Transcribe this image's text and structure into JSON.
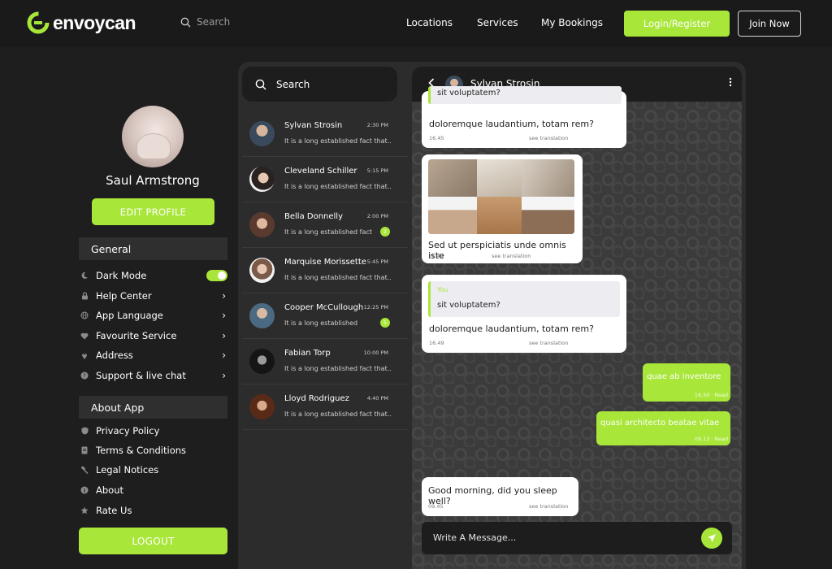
{
  "brand": {
    "name": "envoycan",
    "accent": "#a8e63a"
  },
  "nav": {
    "search_placeholder": "Search",
    "links": [
      "Locations",
      "Services",
      "My Bookings"
    ],
    "login_label": "Login/Register",
    "join_label": "Join Now"
  },
  "profile": {
    "name": "Saul Armstrong",
    "edit_label": "EDIT PROFILE"
  },
  "sidebar": {
    "general_title": "General",
    "general_items": [
      {
        "label": "Dark Mode",
        "icon": "moon-icon",
        "control": "toggle",
        "value": true
      },
      {
        "label": "Help Center",
        "icon": "lock-icon",
        "control": "chevron"
      },
      {
        "label": "App Language",
        "icon": "globe-icon",
        "control": "chevron"
      },
      {
        "label": "Favourite Service",
        "icon": "heart-icon",
        "control": "chevron"
      },
      {
        "label": "Address",
        "icon": "location-pin-icon",
        "control": "chevron"
      },
      {
        "label": "Support & live chat",
        "icon": "help-icon",
        "control": "chevron"
      }
    ],
    "about_title": "About App",
    "about_items": [
      {
        "label": "Privacy Policy",
        "icon": "shield-icon"
      },
      {
        "label": "Terms & Conditions",
        "icon": "document-icon"
      },
      {
        "label": "Legal Notices",
        "icon": "gavel-icon"
      },
      {
        "label": "About",
        "icon": "info-icon"
      },
      {
        "label": "Rate Us",
        "icon": "star-icon"
      }
    ],
    "logout_label": "LOGOUT"
  },
  "chat_list": {
    "search_placeholder": "Search",
    "conversations": [
      {
        "name": "Sylvan Strosin",
        "time": "2:30 PM",
        "preview": "It is a long established fact that...",
        "badge": ""
      },
      {
        "name": "Cleveland Schiller",
        "time": "5:15 PM",
        "preview": "It is a long established fact that...",
        "badge": ""
      },
      {
        "name": "Bella Donnelly",
        "time": "2:00 PM",
        "preview": "It is a long established fact",
        "badge": "2"
      },
      {
        "name": "Marquise Morissette",
        "time": "5:45 PM",
        "preview": "It is a long established fact that...",
        "badge": ""
      },
      {
        "name": "Cooper McCullough",
        "time": "12:25 PM",
        "preview": "It is a long established",
        "badge": "5"
      },
      {
        "name": "Fabian Torp",
        "time": "10:00 PM",
        "preview": "It is a long established fact that...",
        "badge": ""
      },
      {
        "name": "Lloyd Rodriguez",
        "time": "4:40 PM",
        "preview": "It is a long established fact that...",
        "badge": ""
      }
    ]
  },
  "conversation": {
    "contact_name": "Sylvan Strosin",
    "messages": {
      "m1_quote": "sit voluptatem?",
      "m1_text": "doloremque laudantium, totam rem?",
      "m1_time": "16.45",
      "m1_see": "see translation",
      "m2_text": "Sed ut perspiciatis unde omnis iste",
      "m2_time": "16.48",
      "m2_see": "see translation",
      "m3_quote_author": "You",
      "m3_quote": "sit voluptatem?",
      "m3_text": "doloremque laudantium, totam rem?",
      "m3_time": "16.49",
      "m3_see": "see translation",
      "o1_text": "quae ab inventore",
      "o1_meta": "16.50 · Read",
      "o2_text": "quasi architecto beatae vitae",
      "o2_meta": "09.13 · Read",
      "m4_text": "Good morning, did you sleep well?",
      "m4_time": "09.45",
      "m4_see": "see translation"
    },
    "composer_placeholder": "Write A Message..."
  }
}
